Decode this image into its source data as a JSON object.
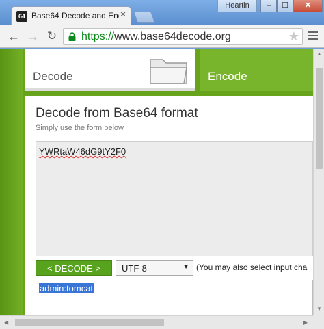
{
  "browser": {
    "tab": {
      "favicon_text": "64",
      "title": "Base64 Decode and Encode",
      "close_glyph": "✕"
    },
    "user": "Heartin",
    "window": {
      "min_glyph": "–",
      "max_glyph": "☐",
      "close_glyph": "✕"
    },
    "nav": {
      "back_glyph": "←",
      "forward_glyph": "→",
      "reload_glyph": "↻"
    },
    "address": {
      "scheme": "https://",
      "host": "www.base64decode.org"
    },
    "star_glyph": "★",
    "icons": [
      "favicon-icon",
      "close-icon",
      "lock-icon",
      "star-icon",
      "menu-icon",
      "folder-icon"
    ]
  },
  "site": {
    "tabs": {
      "decode": "Decode",
      "encode": "Encode"
    },
    "heading": "Decode from Base64 format",
    "subheading": "Simply use the form below",
    "input_value": "YWRtaW46dG9tY2F0",
    "decode_button": "< DECODE >",
    "charset": "UTF-8",
    "charset_note": "(You may also select input cha",
    "output_value": "admin:tomcat",
    "colors": {
      "green": "#68a31c",
      "button_green": "#58a31e",
      "selection": "#3875d7"
    }
  }
}
